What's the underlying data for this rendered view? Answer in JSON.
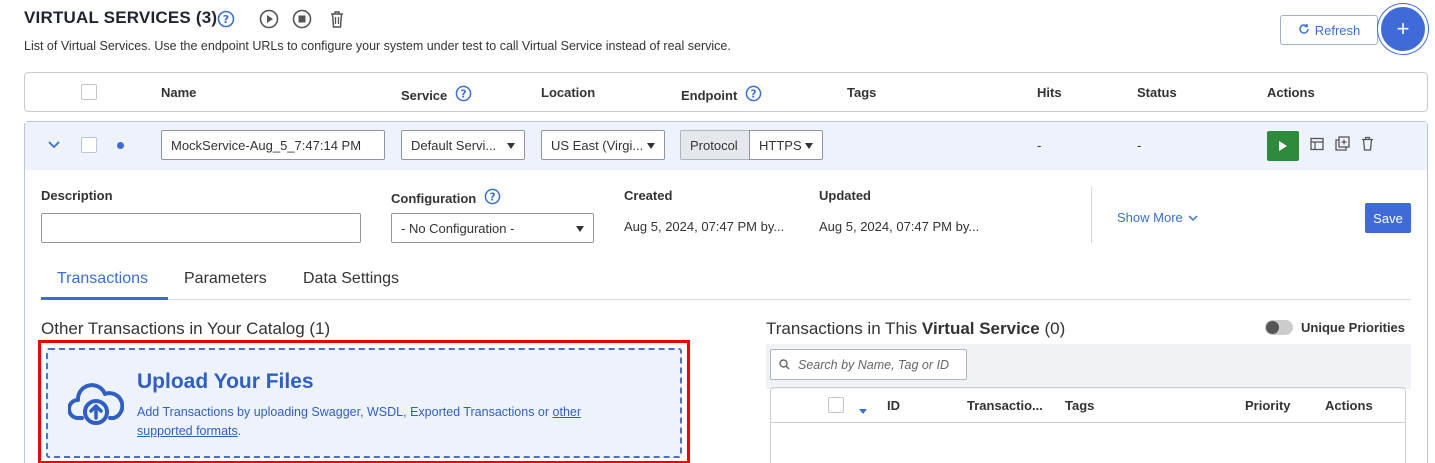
{
  "header": {
    "title": "VIRTUAL SERVICES (3)",
    "subtitle": "List of Virtual Services. Use the endpoint URLs to configure your system under test to call Virtual Service instead of real service.",
    "refresh_label": "Refresh",
    "add_label": "+"
  },
  "table": {
    "columns": [
      "Name",
      "Service",
      "Location",
      "Endpoint",
      "Tags",
      "Hits",
      "Status",
      "Actions"
    ]
  },
  "row": {
    "name": "MockService-Aug_5_7:47:14 PM",
    "service": "Default Servi...",
    "location": "US East (Virgi...",
    "protocol_label": "Protocol",
    "protocol": "HTTPS",
    "hits": "-",
    "status": "-"
  },
  "details": {
    "description_label": "Description",
    "description_value": "",
    "configuration_label": "Configuration",
    "configuration_value": "- No Configuration -",
    "created_label": "Created",
    "created_value": "Aug 5, 2024, 07:47 PM by...",
    "updated_label": "Updated",
    "updated_value": "Aug 5, 2024, 07:47 PM by...",
    "show_more": "Show More",
    "save": "Save"
  },
  "tabs": [
    "Transactions",
    "Parameters",
    "Data Settings"
  ],
  "catalog": {
    "title": "Other Transactions in Your Catalog (1)",
    "upload_title": "Upload Your Files",
    "upload_text": "Add Transactions by uploading Swagger, WSDL, Exported Transactions or ",
    "upload_link_1": "other",
    "upload_link_2": "supported formats",
    "upload_end": "."
  },
  "vs_transactions": {
    "title_prefix": "Transactions in This ",
    "title_bold": "Virtual Service",
    "title_suffix": " (0)",
    "unique_priorities": "Unique Priorities",
    "search_placeholder": "Search by Name, Tag or ID",
    "columns": [
      "ID",
      "Transactio...",
      "Tags",
      "Priority",
      "Actions"
    ]
  },
  "colors": {
    "accent": "#3f6ad8",
    "run_button": "#2e8b3e",
    "highlight": "#e00000"
  }
}
